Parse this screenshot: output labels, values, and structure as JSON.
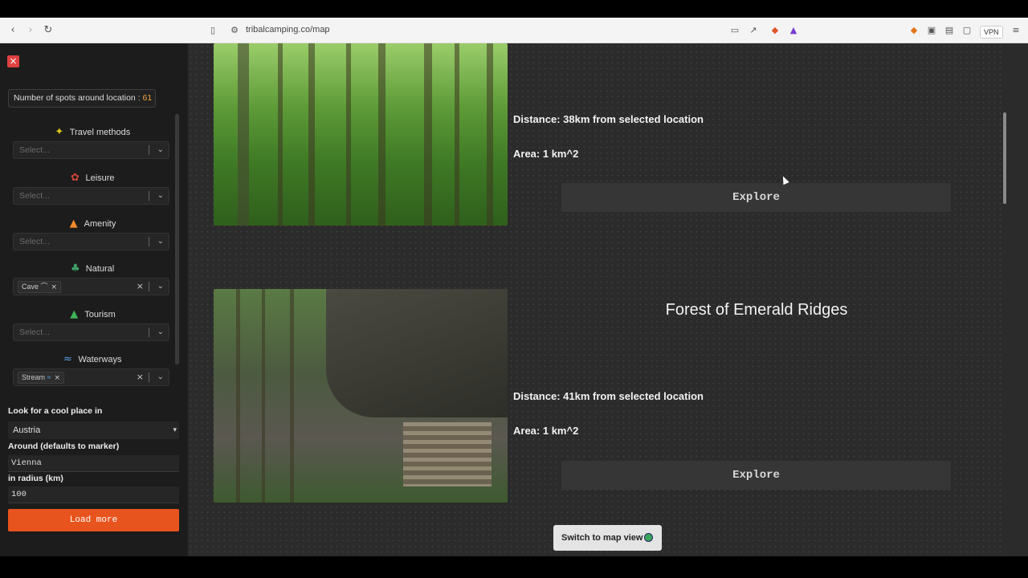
{
  "browser": {
    "url": "tribalcamping.co/map",
    "vpn_label": "VPN"
  },
  "sidebar": {
    "spots_label": "Number of spots around location : ",
    "spots_count": "61",
    "filters": [
      {
        "label": "Travel methods",
        "icon": "travel-icon",
        "placeholder": "Select...",
        "chips": []
      },
      {
        "label": "Leisure",
        "icon": "leisure-icon",
        "placeholder": "Select...",
        "chips": []
      },
      {
        "label": "Amenity",
        "icon": "fire-icon",
        "placeholder": "Select...",
        "chips": []
      },
      {
        "label": "Natural",
        "icon": "tree-icon",
        "placeholder": "",
        "chips": [
          {
            "label": "Cave"
          }
        ]
      },
      {
        "label": "Tourism",
        "icon": "tent-icon",
        "placeholder": "Select...",
        "chips": []
      },
      {
        "label": "Waterways",
        "icon": "wave-icon",
        "placeholder": "",
        "chips": [
          {
            "label": "Stream"
          }
        ]
      }
    ],
    "look_label": "Look for a cool place in",
    "country_value": "Austria",
    "around_label": "Around (defaults to marker)",
    "around_value": "Vienna",
    "radius_label": "in radius (km)",
    "radius_value": "100",
    "load_more_label": "Load more"
  },
  "cards": [
    {
      "title": "",
      "distance": "Distance: 38km from selected location",
      "area": "Area: 1 km^2",
      "explore_label": "Explore"
    },
    {
      "title": "Forest of Emerald Ridges",
      "distance": "Distance: 41km from selected location",
      "area": "Area: 1 km^2",
      "explore_label": "Explore"
    }
  ],
  "switch_label": "Switch to map view",
  "colors": {
    "accent": "#e8541d",
    "sidebar_bg": "#1c1c1c",
    "main_bg": "#2b2b2b"
  }
}
